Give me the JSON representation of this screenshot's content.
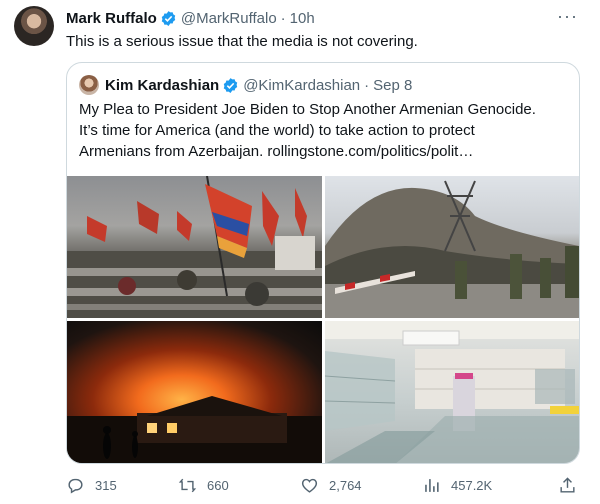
{
  "author": {
    "name": "Mark Ruffalo",
    "handle": "@MarkRuffalo",
    "separator": "·",
    "time": "10h"
  },
  "tweet": {
    "text": "This is a serious issue that the media is not covering."
  },
  "more_label": "···",
  "quote": {
    "author": {
      "name": "Kim Kardashian",
      "handle": "@KimKardashian",
      "separator": "·",
      "date": "Sep 8"
    },
    "lines": [
      "My Plea to President Joe Biden to Stop Another Armenian Genocide.",
      "It’s time for America (and the world) to take action to protect",
      "Armenians from Azerbaijan. rollingstone.com/politics/polit…"
    ]
  },
  "stats": {
    "replies": "315",
    "retweets": "660",
    "likes": "2,764",
    "views": "457.2K"
  },
  "colors": {
    "verified": "#1d9bf0",
    "muted": "#536471"
  }
}
